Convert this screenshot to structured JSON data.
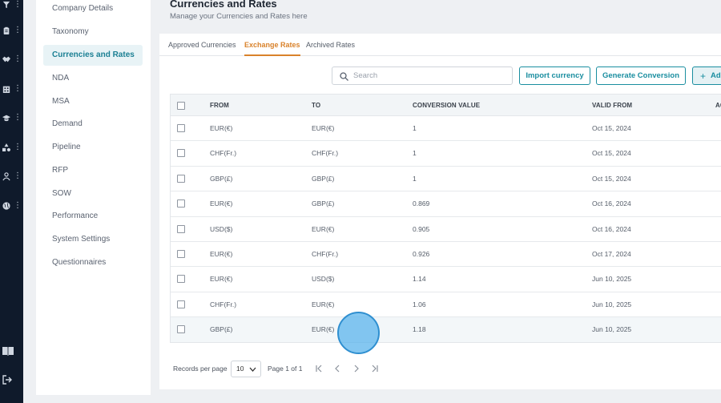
{
  "rail": {
    "icons": [
      "filter-icon",
      "clipboard-icon",
      "handshake-icon",
      "building-icon",
      "graduation-cap-icon",
      "shapes-icon",
      "user-icon",
      "globe-icon"
    ],
    "bottom_icons": [
      "book-icon",
      "logout-icon"
    ]
  },
  "menu": {
    "items": [
      {
        "label": "Company Details",
        "active": false
      },
      {
        "label": "Taxonomy",
        "active": false
      },
      {
        "label": "Currencies and Rates",
        "active": true
      },
      {
        "label": "NDA",
        "active": false
      },
      {
        "label": "MSA",
        "active": false
      },
      {
        "label": "Demand",
        "active": false
      },
      {
        "label": "Pipeline",
        "active": false
      },
      {
        "label": "RFP",
        "active": false
      },
      {
        "label": "SOW",
        "active": false
      },
      {
        "label": "Performance",
        "active": false
      },
      {
        "label": "System Settings",
        "active": false
      },
      {
        "label": "Questionnaires",
        "active": false
      }
    ]
  },
  "header": {
    "title": "Currencies and Rates",
    "subtitle": "Manage your Currencies and Rates here"
  },
  "tabs": [
    {
      "label": "Approved Currencies",
      "active": false
    },
    {
      "label": "Exchange Rates",
      "active": true
    },
    {
      "label": "Archived Rates",
      "active": false
    }
  ],
  "toolbar": {
    "search_placeholder": "Search",
    "import_label": "Import currency",
    "generate_label": "Generate Conversion",
    "add_label": "Ad"
  },
  "table": {
    "columns": [
      "FROM",
      "TO",
      "CONVERSION VALUE",
      "VALID FROM",
      "AC"
    ],
    "rows": [
      {
        "from": "EUR(€)",
        "to": "EUR(€)",
        "value": "1",
        "valid_from": "Oct 15, 2024"
      },
      {
        "from": "CHF(Fr.)",
        "to": "CHF(Fr.)",
        "value": "1",
        "valid_from": "Oct 15, 2024"
      },
      {
        "from": "GBP(£)",
        "to": "GBP(£)",
        "value": "1",
        "valid_from": "Oct 15, 2024"
      },
      {
        "from": "EUR(€)",
        "to": "GBP(£)",
        "value": "0.869",
        "valid_from": "Oct 16, 2024"
      },
      {
        "from": "USD($)",
        "to": "EUR(€)",
        "value": "0.905",
        "valid_from": "Oct 16, 2024"
      },
      {
        "from": "EUR(€)",
        "to": "CHF(Fr.)",
        "value": "0.926",
        "valid_from": "Oct 17, 2024"
      },
      {
        "from": "EUR(€)",
        "to": "USD($)",
        "value": "1.14",
        "valid_from": "Jun 10, 2025"
      },
      {
        "from": "CHF(Fr.)",
        "to": "EUR(€)",
        "value": "1.06",
        "valid_from": "Jun 10, 2025"
      },
      {
        "from": "GBP(£)",
        "to": "EUR(€)",
        "value": "1.18",
        "valid_from": "Jun 10, 2025"
      }
    ]
  },
  "pagination": {
    "records_label": "Records per page",
    "per_page": "10",
    "page_info": "Page 1 of 1"
  },
  "colors": {
    "accent": "#1a8ea0",
    "tab_active": "#d9822b",
    "rail_bg": "#0f1a2b"
  }
}
